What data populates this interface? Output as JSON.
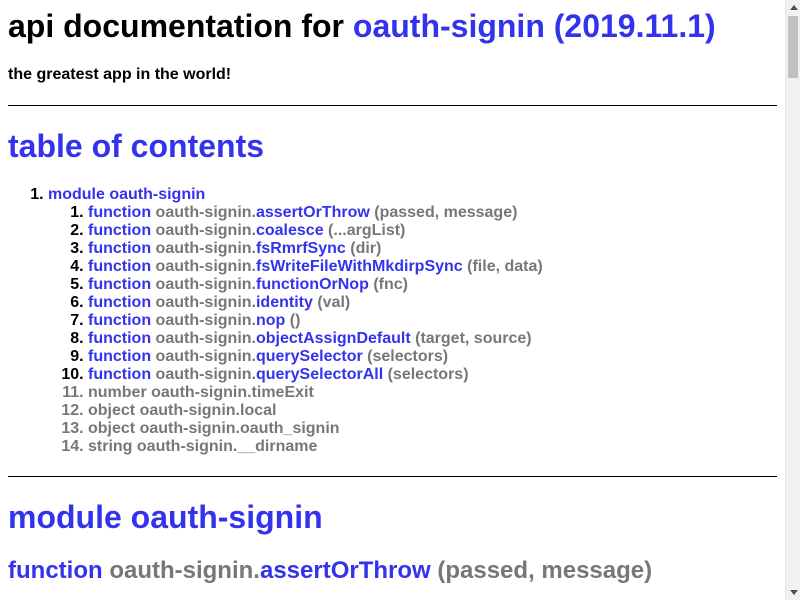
{
  "header": {
    "title_prefix": "api documentation for",
    "title_link": "oauth-signin (2019.11.1)",
    "tagline": "the greatest app in the world!"
  },
  "toc": {
    "heading": "table of contents",
    "module_item": "module oauth-signin",
    "items": [
      {
        "kind": "function",
        "ns": "oauth-signin.",
        "name": "assertOrThrow",
        "args": "(passed, message)"
      },
      {
        "kind": "function",
        "ns": "oauth-signin.",
        "name": "coalesce",
        "args": "(...argList)"
      },
      {
        "kind": "function",
        "ns": "oauth-signin.",
        "name": "fsRmrfSync",
        "args": "(dir)"
      },
      {
        "kind": "function",
        "ns": "oauth-signin.",
        "name": "fsWriteFileWithMkdirpSync",
        "args": "(file, data)"
      },
      {
        "kind": "function",
        "ns": "oauth-signin.",
        "name": "functionOrNop",
        "args": "(fnc)"
      },
      {
        "kind": "function",
        "ns": "oauth-signin.",
        "name": "identity",
        "args": "(val)"
      },
      {
        "kind": "function",
        "ns": "oauth-signin.",
        "name": "nop",
        "args": "()"
      },
      {
        "kind": "function",
        "ns": "oauth-signin.",
        "name": "objectAssignDefault",
        "args": "(target, source)"
      },
      {
        "kind": "function",
        "ns": "oauth-signin.",
        "name": "querySelector",
        "args": "(selectors)"
      },
      {
        "kind": "function",
        "ns": "oauth-signin.",
        "name": "querySelectorAll",
        "args": "(selectors)"
      }
    ],
    "plain_items": [
      "number oauth-signin.timeExit",
      "object oauth-signin.local",
      "object oauth-signin.oauth_signin",
      "string oauth-signin.__dirname"
    ]
  },
  "module_section": {
    "heading": "module oauth-signin",
    "first_function": {
      "kind": "function",
      "ns": "oauth-signin.",
      "name": "assertOrThrow",
      "args": "(passed, message)"
    }
  },
  "colors": {
    "link": "#3333ee",
    "muted": "#777777"
  }
}
